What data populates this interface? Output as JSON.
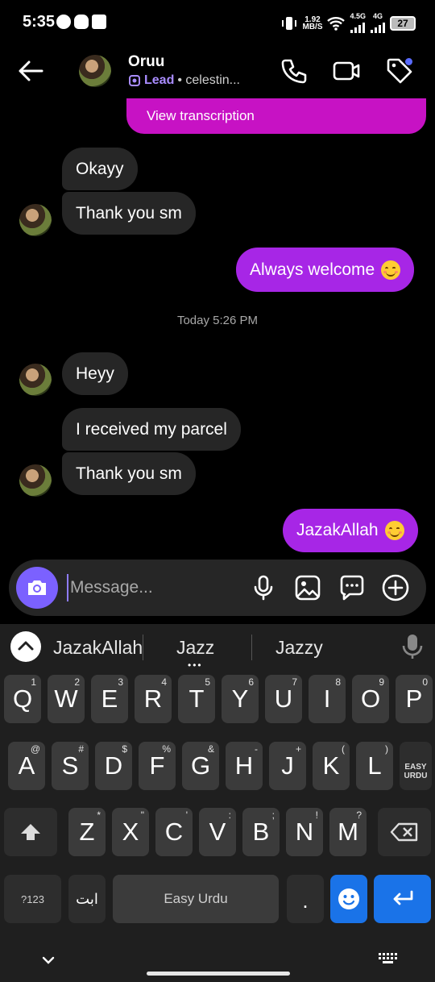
{
  "status": {
    "time": "5:35",
    "net_speed_value": "1.92",
    "net_speed_unit": "MB/S",
    "net1": "4.5G",
    "net2": "4G",
    "battery": "27"
  },
  "header": {
    "contact_name": "Oruu",
    "lead_label": "Lead",
    "handle": "• celestin...",
    "icons": [
      "back-arrow-icon",
      "phone-icon",
      "video-icon",
      "tag-icon"
    ]
  },
  "messages": {
    "transcription_link": "View transcription",
    "in1": "Okayy",
    "in2": "Thank you sm",
    "out1": "Always welcome",
    "timestamp": "Today 5:26 PM",
    "in3": "Heyy",
    "in4": "I received my parcel",
    "in5": "Thank you sm",
    "out2": "JazakAllah"
  },
  "composer": {
    "placeholder": "Message...",
    "icons": [
      "camera-icon",
      "mic-icon",
      "gallery-icon",
      "sticker-icon",
      "plus-icon"
    ]
  },
  "keyboard": {
    "suggestions": [
      "JazakAllah",
      "Jazz",
      "Jazzy"
    ],
    "row1": [
      [
        "Q",
        "1"
      ],
      [
        "W",
        "2"
      ],
      [
        "E",
        "3"
      ],
      [
        "R",
        "4"
      ],
      [
        "T",
        "5"
      ],
      [
        "Y",
        "6"
      ],
      [
        "U",
        "7"
      ],
      [
        "I",
        "8"
      ],
      [
        "O",
        "9"
      ],
      [
        "P",
        "0"
      ]
    ],
    "row2": [
      [
        "A",
        "@"
      ],
      [
        "S",
        "#"
      ],
      [
        "D",
        "$"
      ],
      [
        "F",
        "%"
      ],
      [
        "G",
        "&"
      ],
      [
        "H",
        "-"
      ],
      [
        "J",
        "+"
      ],
      [
        "K",
        "("
      ],
      [
        "L",
        ")"
      ]
    ],
    "row3": [
      [
        "Z",
        "*"
      ],
      [
        "X",
        "\""
      ],
      [
        "C",
        "'"
      ],
      [
        "V",
        ":"
      ],
      [
        "B",
        ";"
      ],
      [
        "N",
        "!"
      ],
      [
        "M",
        "?"
      ]
    ],
    "easy_urdu_key": "EASY\nURDU",
    "symbols_key": "?123",
    "urdu_key": "ابت",
    "space_label": "Easy Urdu",
    "period_key": "."
  },
  "colors": {
    "outgoing_bubble": "#a726e6",
    "incoming_bubble": "#262626",
    "accent": "#7b61ff",
    "transcription": "#c712c4",
    "keyboard_accent": "#1a73e8"
  }
}
